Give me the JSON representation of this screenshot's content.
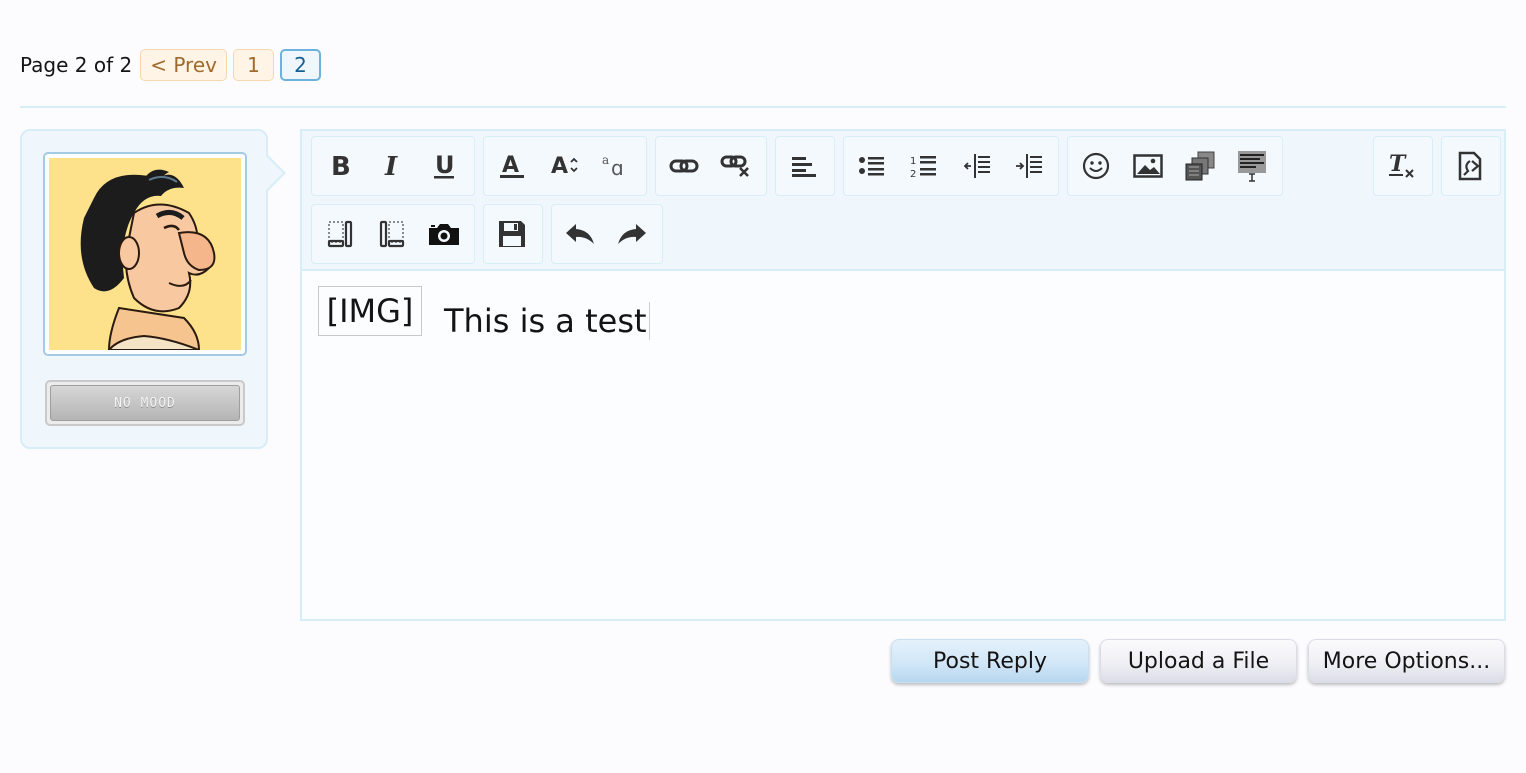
{
  "pagination": {
    "page_text": "Page 2 of 2",
    "prev_label": "< Prev",
    "pages": [
      "1",
      "2"
    ],
    "current_page": "2"
  },
  "user": {
    "avatar_icon": "cartoon-character-avatar",
    "mood_label": "NO MOOD"
  },
  "editor": {
    "toolbar_buttons": [
      "bold-icon",
      "italic-icon",
      "underline-icon",
      "font-color-icon",
      "font-size-icon",
      "font-family-icon",
      "link-icon",
      "unlink-icon",
      "align-icon",
      "bullet-list-icon",
      "numbered-list-icon",
      "outdent-icon",
      "indent-icon",
      "smilies-icon",
      "image-icon",
      "media-icon",
      "quote-icon",
      "remove-format-icon",
      "toggle-bbcode-icon",
      "float-left-icon",
      "float-right-icon",
      "camera-icon",
      "save-draft-icon",
      "undo-icon",
      "redo-icon"
    ],
    "image_placeholder": "[IMG]",
    "body_text": "This is a test"
  },
  "buttons": {
    "post_reply": "Post Reply",
    "upload_file": "Upload a File",
    "more_options": "More Options..."
  },
  "colors": {
    "accent_border": "#d7edf7",
    "accent_bg": "#f0f7fc",
    "pagenav_bg": "#fff4e5",
    "pagenav_text": "#a06a2c",
    "current_page_border": "#6cb2dc"
  }
}
